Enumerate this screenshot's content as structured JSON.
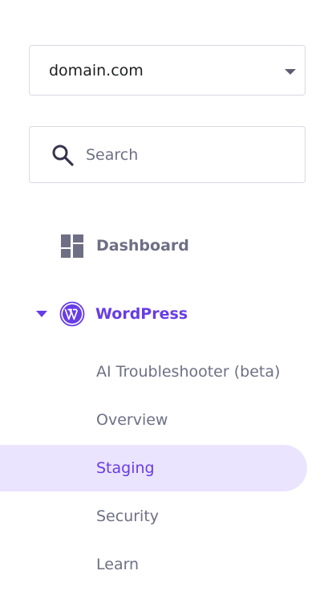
{
  "domain_select": {
    "value": "domain.com"
  },
  "search": {
    "placeholder": "Search"
  },
  "nav": {
    "dashboard_label": "Dashboard",
    "wordpress_label": "WordPress",
    "wordpress_items": [
      {
        "label": "AI Troubleshooter (beta)"
      },
      {
        "label": "Overview"
      },
      {
        "label": "Staging"
      },
      {
        "label": "Security"
      },
      {
        "label": "Learn"
      }
    ],
    "active_item": "Staging"
  },
  "colors": {
    "accent": "#673de6",
    "active_bg": "#ebe4ff",
    "text_muted": "#6e6f85",
    "border": "#d9d9e3"
  },
  "icons": {
    "search": "search-icon",
    "dashboard": "dashboard-icon",
    "wordpress": "wordpress-icon",
    "dropdown": "chevron-down-icon",
    "expand": "caret-down-icon"
  }
}
